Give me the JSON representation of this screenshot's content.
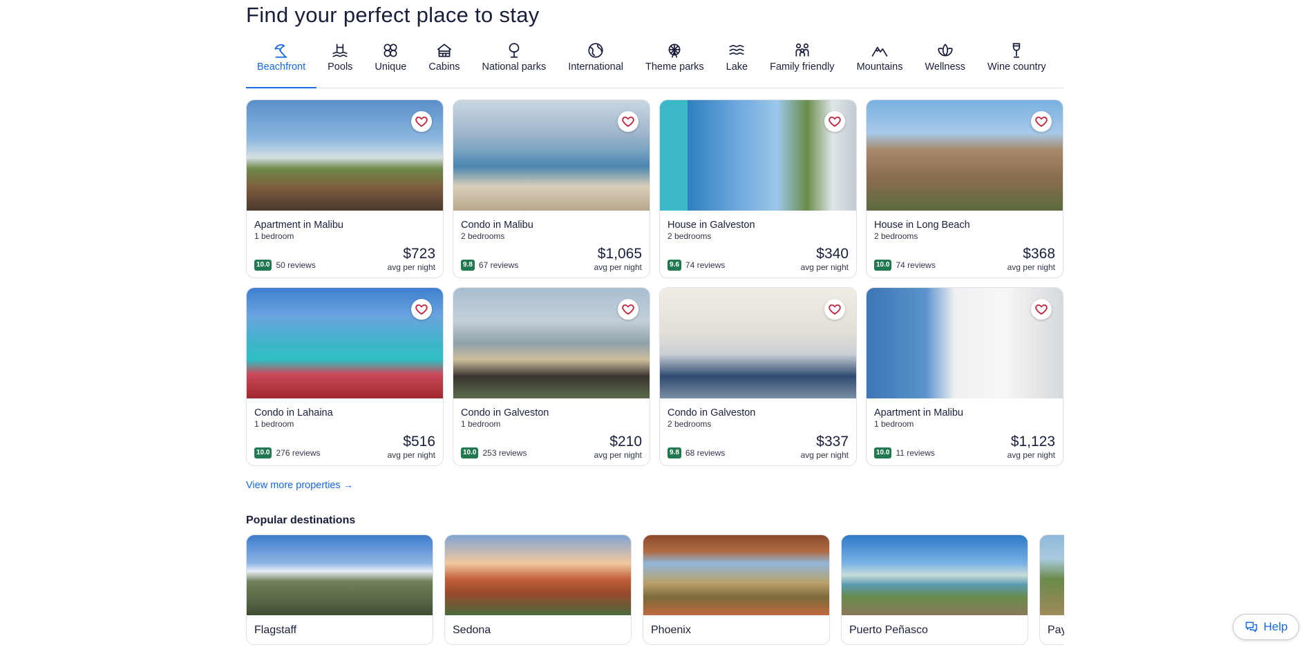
{
  "page_title": "Find your perfect place to stay",
  "tabs": [
    {
      "label": "Beachfront",
      "icon": "beachfront-umbrella-icon",
      "active": true
    },
    {
      "label": "Pools",
      "icon": "pool-icon",
      "active": false
    },
    {
      "label": "Unique",
      "icon": "unique-icon",
      "active": false
    },
    {
      "label": "Cabins",
      "icon": "cabin-icon",
      "active": false
    },
    {
      "label": "National parks",
      "icon": "national-park-tree-icon",
      "active": false
    },
    {
      "label": "International",
      "icon": "globe-icon",
      "active": false
    },
    {
      "label": "Theme parks",
      "icon": "ferris-wheel-icon",
      "active": false
    },
    {
      "label": "Lake",
      "icon": "waves-icon",
      "active": false
    },
    {
      "label": "Family friendly",
      "icon": "family-icon",
      "active": false
    },
    {
      "label": "Mountains",
      "icon": "mountain-icon",
      "active": false
    },
    {
      "label": "Wellness",
      "icon": "lotus-icon",
      "active": false
    },
    {
      "label": "Wine country",
      "icon": "wine-glass-icon",
      "active": false
    }
  ],
  "properties": [
    {
      "type": "Apartment in Malibu",
      "bedrooms": "1 bedroom",
      "rating": "10.0",
      "reviews": "50 reviews",
      "price": "$723",
      "price_note": "avg per night",
      "scene": "s-malibu1"
    },
    {
      "type": "Condo in Malibu",
      "bedrooms": "2 bedrooms",
      "rating": "9.8",
      "reviews": "67 reviews",
      "price": "$1,065",
      "price_note": "avg per night",
      "scene": "s-condo1"
    },
    {
      "type": "House in Galveston",
      "bedrooms": "2 bedrooms",
      "rating": "9.6",
      "reviews": "74 reviews",
      "price": "$340",
      "price_note": "avg per night",
      "scene": "s-galv1"
    },
    {
      "type": "House in Long Beach",
      "bedrooms": "2 bedrooms",
      "rating": "10.0",
      "reviews": "74 reviews",
      "price": "$368",
      "price_note": "avg per night",
      "scene": "s-long"
    },
    {
      "type": "Condo in Lahaina",
      "bedrooms": "1 bedroom",
      "rating": "10.0",
      "reviews": "276 reviews",
      "price": "$516",
      "price_note": "avg per night",
      "scene": "s-lahaina"
    },
    {
      "type": "Condo in Galveston",
      "bedrooms": "1 bedroom",
      "rating": "10.0",
      "reviews": "253 reviews",
      "price": "$210",
      "price_note": "avg per night",
      "scene": "s-galv2"
    },
    {
      "type": "Condo in Galveston",
      "bedrooms": "2 bedrooms",
      "rating": "9.8",
      "reviews": "68 reviews",
      "price": "$337",
      "price_note": "avg per night",
      "scene": "s-galv3"
    },
    {
      "type": "Apartment in Malibu",
      "bedrooms": "1 bedroom",
      "rating": "10.0",
      "reviews": "11 reviews",
      "price": "$1,123",
      "price_note": "avg per night",
      "scene": "s-malibu2"
    }
  ],
  "view_more": "View more properties →",
  "popular_title": "Popular destinations",
  "destinations": [
    {
      "name": "Flagstaff",
      "scene": "s-flag"
    },
    {
      "name": "Sedona",
      "scene": "s-sedona"
    },
    {
      "name": "Phoenix",
      "scene": "s-phoenix"
    },
    {
      "name": "Puerto Peñasco",
      "scene": "s-puerto"
    },
    {
      "name": "Pay",
      "scene": "s-payson"
    }
  ],
  "help_label": "Help",
  "colors": {
    "accent": "#1668e3",
    "rating_badge": "#227950",
    "text": "#191e3b",
    "heart": "#c4243f"
  }
}
